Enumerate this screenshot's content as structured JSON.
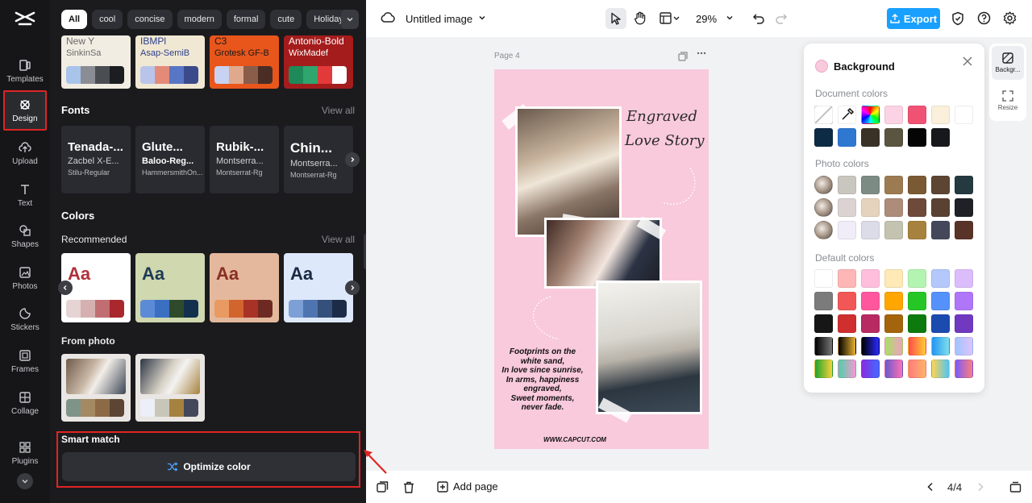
{
  "rail": {
    "items": [
      {
        "label": "Templates",
        "icon": "templates-icon"
      },
      {
        "label": "Design",
        "icon": "design-icon"
      },
      {
        "label": "Upload",
        "icon": "upload-icon"
      },
      {
        "label": "Text",
        "icon": "text-icon"
      },
      {
        "label": "Shapes",
        "icon": "shapes-icon"
      },
      {
        "label": "Photos",
        "icon": "photos-icon"
      },
      {
        "label": "Stickers",
        "icon": "stickers-icon"
      },
      {
        "label": "Frames",
        "icon": "frames-icon"
      },
      {
        "label": "Collage",
        "icon": "collage-icon"
      },
      {
        "label": "Plugins",
        "icon": "plugins-icon"
      }
    ],
    "active": "Design"
  },
  "panel": {
    "chips": [
      "All",
      "cool",
      "concise",
      "modern",
      "formal",
      "cute",
      "Holiday"
    ],
    "top_cards": [
      {
        "line1": "New Y",
        "line2": "SinkinSa",
        "swatches": [
          "#a8c4ea",
          "#8a8d93",
          "#4a4d52",
          "#1c1d20"
        ],
        "bg": "#f2ede3",
        "fg": "#6a6a6a"
      },
      {
        "line1": "IBMPl",
        "line2": "Asap-SemiB",
        "swatches": [
          "#b9c4ea",
          "#e48a78",
          "#5876c6",
          "#3b4a8a"
        ],
        "bg": "#f1e8d3",
        "fg": "#2c3f8c"
      },
      {
        "line1": "C3",
        "line2": "Grotesk GF-B",
        "swatches": [
          "#c8d2f2",
          "#e0a98e",
          "#8a5c4a",
          "#4a2d24"
        ],
        "bg": "#e8561c",
        "fg": "#1a1a1a"
      },
      {
        "line1": "Antonio-Bold",
        "line2": "WixMadef",
        "swatches": [
          "#1e8a5a",
          "#2ea66e",
          "#e23a3a",
          "#ffffff"
        ],
        "bg": "#a51c1c",
        "fg": "#ffffff"
      }
    ],
    "fonts_title": "Fonts",
    "fonts_view_all": "View all",
    "fonts": [
      {
        "name": "Tenada-...",
        "sub": "Zacbel X-E...",
        "meta": "Stilu-Regular"
      },
      {
        "name": "Glute...",
        "sub": "Baloo-Reg...",
        "meta": "HammersmithOn..."
      },
      {
        "name": "Rubik-...",
        "sub": "Montserra...",
        "meta": "Montserrat-Rg"
      },
      {
        "name": "Chin...",
        "sub": "Montserra...",
        "meta": "Montserrat-Rg"
      }
    ],
    "colors_title": "Colors",
    "recommended_title": "Recommended",
    "recommended_view_all": "View all",
    "recommended": [
      {
        "text": "Aa",
        "bg": "#ffffff",
        "fg": "#b0303a",
        "swatches": [
          "#e6d3d3",
          "#d6b0b0",
          "#c06e72",
          "#a8282e"
        ]
      },
      {
        "text": "Aa",
        "bg": "#cfd8ae",
        "fg": "#1e3a56",
        "swatches": [
          "#5b8ad6",
          "#3a6fc2",
          "#2f4a2a",
          "#12304e"
        ]
      },
      {
        "text": "Aa",
        "bg": "#e4b89c",
        "fg": "#8a2e24",
        "swatches": [
          "#e89a62",
          "#d2642e",
          "#a93226",
          "#6e2a22"
        ]
      },
      {
        "text": "Aa",
        "bg": "#dde8fa",
        "fg": "#1a2a44",
        "swatches": [
          "#7ca0d6",
          "#4f75b0",
          "#35507a",
          "#1c2c48"
        ]
      }
    ],
    "from_photo_title": "From photo",
    "from_photo": [
      {
        "swatches": [
          "#7f9488",
          "#a38a62",
          "#8c6a46",
          "#5c4532"
        ]
      },
      {
        "swatches": [
          "#eceef8",
          "#c8c6b8",
          "#a68240",
          "#44485a"
        ]
      }
    ],
    "smart_match_title": "Smart match",
    "optimize_label": "Optimize color"
  },
  "topbar": {
    "doc_title": "Untitled image",
    "zoom": "29%",
    "export_label": "Export"
  },
  "canvas": {
    "page_label": "Page 4",
    "poster": {
      "title_line1": "Engraved",
      "title_line2": "Love Story",
      "poem": [
        "Footprints on the",
        "white sand,",
        "In love since sunrise,",
        "In arms, happiness",
        "engraved,",
        "Sweet moments,",
        "never fade."
      ],
      "site": "WWW.CAPCUT.COM",
      "bg": "#f9c9dc"
    }
  },
  "background_panel": {
    "title": "Background",
    "document_colors_label": "Document colors",
    "document_colors": [
      [
        "none",
        "picker",
        "rainbow",
        "#fcd3e4",
        "#f05274",
        "#faf0dc",
        "#ffffff"
      ],
      [
        "#0d2b45",
        "#2f78d2",
        "#3a3226",
        "#5a5540",
        "#050505",
        "#16181c"
      ]
    ],
    "photo_colors_label": "Photo colors",
    "photo_colors": [
      [
        "photo",
        "#c9c6bf",
        "#7c8b84",
        "#9d7b52",
        "#7a5a34",
        "#5c4532",
        "#243a40"
      ],
      [
        "photo",
        "#ddd2d2",
        "#e6d3bd",
        "#ad8c7a",
        "#6e4a3a",
        "#5a4232",
        "#1e2226"
      ],
      [
        "photo",
        "#f0edf8",
        "#dcdce8",
        "#c4c2b0",
        "#a6823e",
        "#44485a",
        "#5a3328"
      ]
    ],
    "default_colors_label": "Default colors",
    "default_colors": [
      [
        "#ffffff",
        "#ffb6b6",
        "#ffbfdc",
        "#ffe9b6",
        "#b3f5b0",
        "#b4c8fb",
        "#dcbdfc"
      ],
      [
        "#7b7b7b",
        "#f25757",
        "#ff579e",
        "#ffa600",
        "#26c626",
        "#5591fa",
        "#b076f9"
      ],
      [
        "#161616",
        "#cf2f2f",
        "#b82a62",
        "#a3640c",
        "#0c7a0c",
        "#1c4bb0",
        "#7039c0"
      ]
    ],
    "gradient_rows": [
      [
        "linear-gradient(90deg,#000,#777)",
        "linear-gradient(90deg,#000,#e8b030)",
        "linear-gradient(90deg,#000,#2a2aff)",
        "linear-gradient(90deg,#a8e063,#f0a0c0)",
        "linear-gradient(90deg,#ff4d4d,#ffcc33)",
        "linear-gradient(90deg,#2196f3,#80deea)",
        "linear-gradient(90deg,#a0c4ff,#e0c3fc)"
      ],
      [
        "linear-gradient(90deg,#1fa32e,#f7d33b)",
        "linear-gradient(90deg,#4dd0a6,#f39ad2)",
        "linear-gradient(90deg,#8a2be2,#3f6bff)",
        "linear-gradient(90deg,#6a5acd,#ff6fb5)",
        "linear-gradient(90deg,#ff7b7b,#ffb46b)",
        "linear-gradient(90deg,#ffd54f,#4fc3f7)",
        "linear-gradient(90deg,#7a5af8,#ff7d7d)"
      ]
    ]
  },
  "right_tools": [
    {
      "label": "Backgr...",
      "icon": "background-icon"
    },
    {
      "label": "Resize",
      "icon": "resize-icon"
    }
  ],
  "bottombar": {
    "add_page_label": "Add page",
    "page_count": "4/4"
  }
}
